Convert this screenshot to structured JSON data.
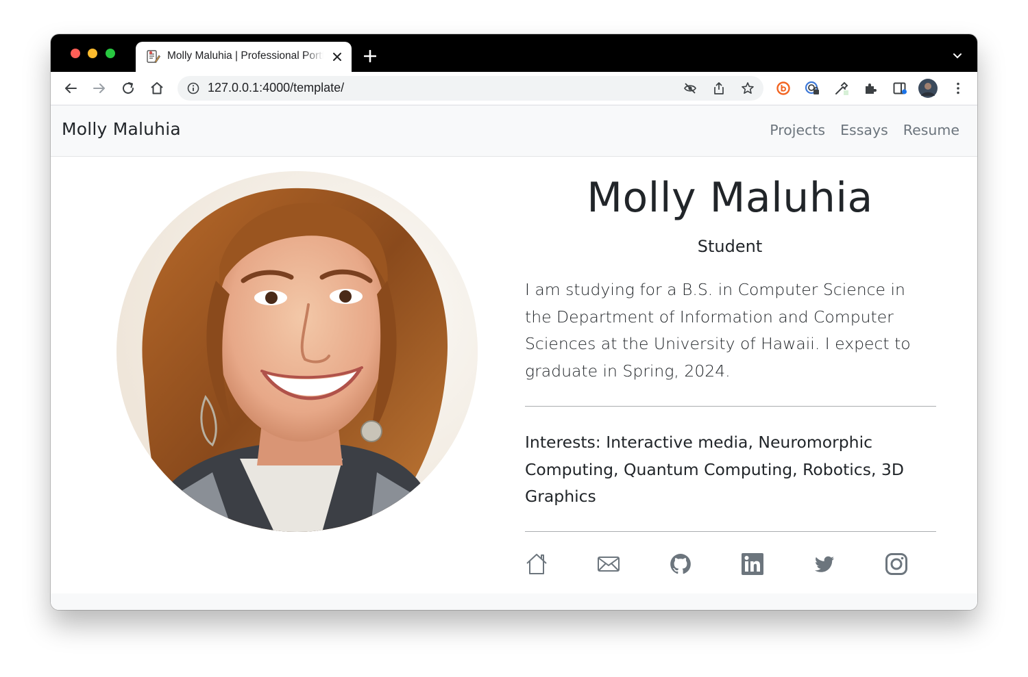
{
  "browser": {
    "tab_title": "Molly Maluhia | Professional Portfolio",
    "url": "127.0.0.1:4000/template/"
  },
  "navbar": {
    "brand": "Molly Maluhia",
    "links": [
      "Projects",
      "Essays",
      "Resume"
    ]
  },
  "profile": {
    "name": "Molly Maluhia",
    "title": "Student",
    "bio": "I am studying for a B.S. in Computer Science in the Department of Information and Computer Sciences at the University of Hawaii. I expect to graduate in Spring, 2024.",
    "interests": "Interests: Interactive media, Neuromorphic Computing, Quantum Computing, Robotics, 3D Graphics"
  },
  "social_icons": [
    "home-icon",
    "envelope-icon",
    "github-icon",
    "linkedin-icon",
    "twitter-icon",
    "instagram-icon"
  ],
  "colors": {
    "navbar_bg": "#f8f9fa",
    "nav_link": "#6c757d",
    "text": "#212529",
    "icon": "#6c757d"
  }
}
